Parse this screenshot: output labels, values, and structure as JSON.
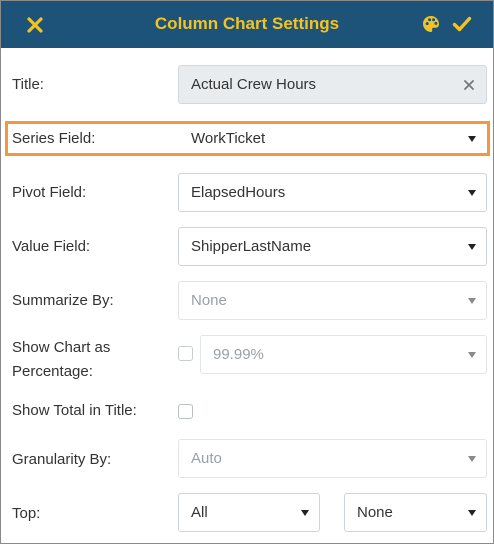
{
  "header": {
    "title": "Column Chart Settings",
    "close_icon": "close-x-icon",
    "palette_icon": "palette-icon",
    "confirm_icon": "checkmark-icon",
    "accent_color": "#f3c324",
    "background_color": "#1d5378"
  },
  "form": {
    "title": {
      "label": "Title:",
      "value": "Actual Crew Hours"
    },
    "series_field": {
      "label": "Series Field:",
      "value": "WorkTicket"
    },
    "pivot_field": {
      "label": "Pivot Field:",
      "value": "ElapsedHours"
    },
    "value_field": {
      "label": "Value Field:",
      "value": "ShipperLastName"
    },
    "summarize_by": {
      "label": "Summarize By:",
      "value": "None"
    },
    "show_percentage": {
      "label_line1": "Show Chart as",
      "label_line2": "Percentage:",
      "checked": false,
      "value": "99.99%"
    },
    "show_total": {
      "label": "Show Total in Title:",
      "checked": false
    },
    "granularity_by": {
      "label": "Granularity By:",
      "value": "Auto"
    },
    "top": {
      "label": "Top:",
      "count_value": "All",
      "field_value": "None"
    }
  },
  "highlight_color": "#f3993b"
}
